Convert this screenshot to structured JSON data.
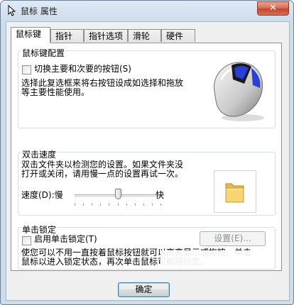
{
  "window": {
    "title": "鼠标 属性",
    "close_label": "✕"
  },
  "tabs": [
    {
      "label": "鼠标键",
      "active": true
    },
    {
      "label": "指针",
      "active": false
    },
    {
      "label": "指针选项",
      "active": false
    },
    {
      "label": "滑轮",
      "active": false
    },
    {
      "label": "硬件",
      "active": false
    }
  ],
  "button_config": {
    "title": "鼠标键配置",
    "swap_label": "切换主要和次要的按钮(S)",
    "swap_checked": false,
    "desc_line1": "选择此复选框来将右按钮设成如选择和拖放",
    "desc_line2": "等主要性能使用。"
  },
  "double_click": {
    "title": "双击速度",
    "desc_line1": "双击文件夹以检测您的设置。如果文件夹没",
    "desc_line2": "打开或关闭，请用慢一点的设置再试一次。",
    "speed_label": "速度(D):慢",
    "fast_label": "快",
    "speed_fraction": 0.5
  },
  "click_lock": {
    "title": "单击锁定",
    "enable_label": "启用单击锁定(T)",
    "enable_checked": false,
    "settings_label": "设置(E)...",
    "desc_line1": "使您可以不用一直按着鼠标按钮就可以高亮显示或拖拽。单击",
    "desc_line2": "鼠标以进入锁定状态，再次单击鼠标可解除锁定。"
  },
  "footer": {
    "ok_label": "确定"
  },
  "icons": {
    "title": "mouse-pointer-icon",
    "mouse": "mouse-image",
    "folder": "folder-icon"
  }
}
